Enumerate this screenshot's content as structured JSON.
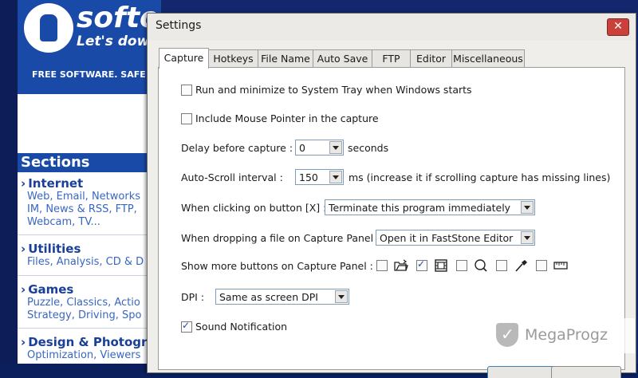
{
  "website": {
    "logo_text": "softo",
    "tagline": "Let's dow",
    "free_text": "FREE SOFTWARE. SAFE D",
    "sections_title": "Sections",
    "categories": [
      {
        "title": "Internet",
        "lines": [
          "Web, Email, Networks",
          "IM, News & RSS, FTP,",
          "Webcam, TV..."
        ]
      },
      {
        "title": "Utilities",
        "lines": [
          "Files, Analysis, CD & D"
        ]
      },
      {
        "title": "Games",
        "lines": [
          "Puzzle, Classics, Actio",
          "Strategy, Driving, Spo"
        ]
      },
      {
        "title": "Design & Photogra",
        "lines": [
          "Optimization, Viewers"
        ]
      }
    ]
  },
  "dialog": {
    "title": "Settings",
    "close_label": "✕",
    "tabs": [
      {
        "label": "Capture",
        "active": true
      },
      {
        "label": "Hotkeys",
        "active": false
      },
      {
        "label": "File Name",
        "active": false
      },
      {
        "label": "Auto Save",
        "active": false
      },
      {
        "label": "FTP",
        "active": false
      },
      {
        "label": "Editor",
        "active": false
      },
      {
        "label": "Miscellaneous",
        "active": false
      }
    ],
    "capture": {
      "run_minimize": {
        "label": "Run and minimize to System Tray when Windows starts",
        "checked": false
      },
      "mouse_pointer": {
        "label": "Include Mouse Pointer in the capture",
        "checked": false
      },
      "delay": {
        "label": "Delay before capture :",
        "value": "0",
        "suffix": "seconds"
      },
      "autoscroll": {
        "label": "Auto-Scroll interval :",
        "value": "150",
        "suffix": "ms (increase it if scrolling capture has missing lines)"
      },
      "click_x": {
        "label": "When clicking on button [X] :",
        "value": "Terminate this program immediately"
      },
      "drop_file": {
        "label": "When dropping a file on Capture Panel :",
        "value": "Open it in FastStone Editor"
      },
      "more_buttons": {
        "label": "Show more buttons on Capture Panel :",
        "items": [
          {
            "icon": "folder-open-icon",
            "checked": false
          },
          {
            "icon": "film-icon",
            "checked": true
          },
          {
            "icon": "magnifier-icon",
            "checked": false
          },
          {
            "icon": "eyedropper-icon",
            "checked": false
          },
          {
            "icon": "ruler-icon",
            "checked": false
          }
        ]
      },
      "dpi": {
        "label": "DPI :",
        "value": "Same as screen DPI"
      },
      "sound": {
        "label": "Sound Notification",
        "checked": true
      }
    }
  },
  "watermark": {
    "text": "MegaProgz"
  }
}
